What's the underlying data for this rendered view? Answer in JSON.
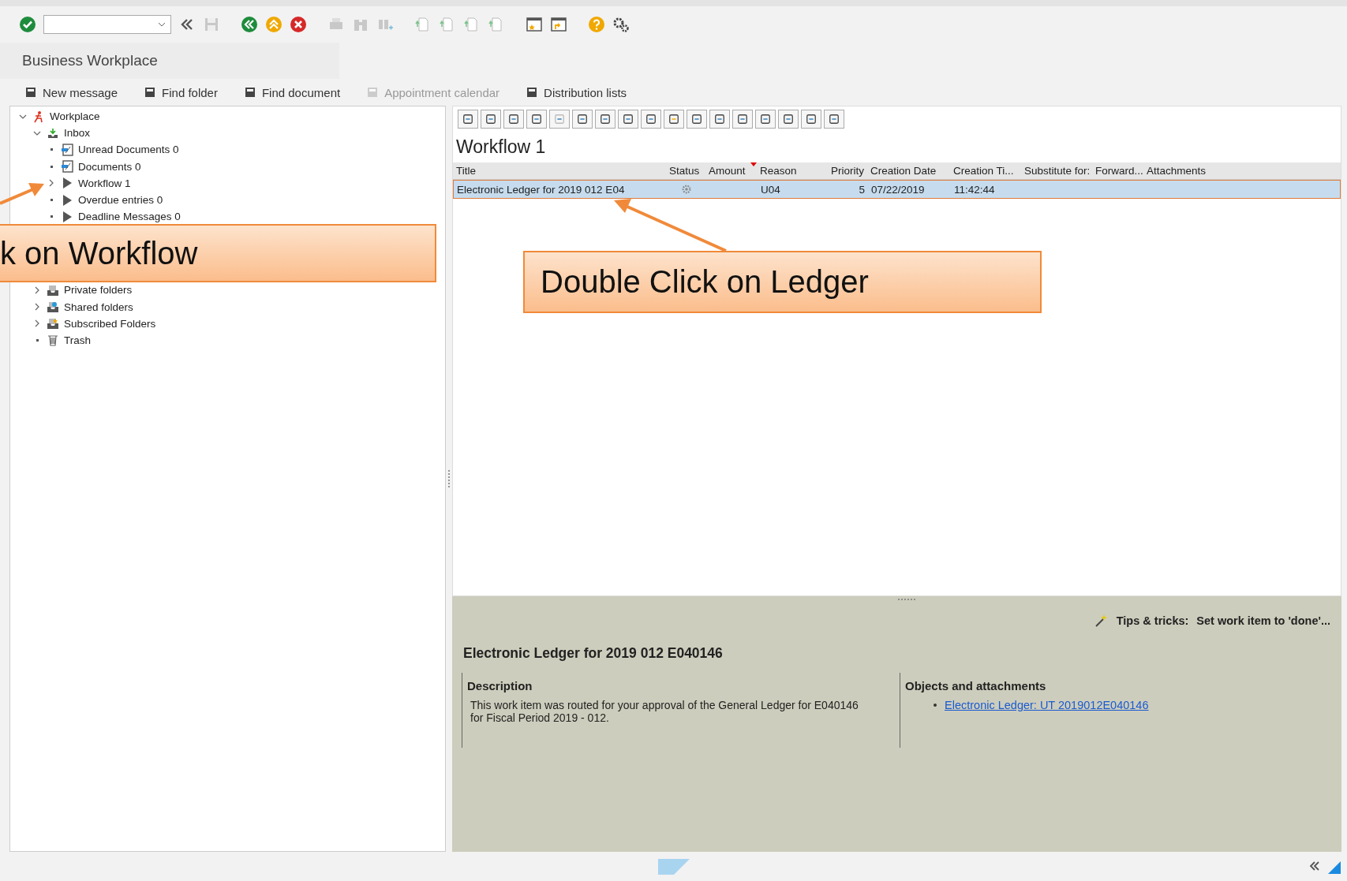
{
  "screen_title": "Business Workplace",
  "app_toolbar": [
    {
      "label": "New message",
      "disabled": false
    },
    {
      "label": "Find folder",
      "disabled": false
    },
    {
      "label": "Find document",
      "disabled": false
    },
    {
      "label": "Appointment calendar",
      "disabled": true
    },
    {
      "label": "Distribution lists",
      "disabled": false
    }
  ],
  "tree": [
    {
      "label": "Workplace",
      "kind": "root",
      "expanded": true,
      "children": [
        {
          "label": "Inbox",
          "kind": "inbox",
          "expanded": true,
          "children": [
            {
              "label": "Unread Documents 0",
              "kind": "documents"
            },
            {
              "label": "Documents 0",
              "kind": "documents"
            },
            {
              "label": "Workflow 1",
              "kind": "workflow",
              "expanded": false
            },
            {
              "label": "Overdue entries 0",
              "kind": "workflow"
            },
            {
              "label": "Deadline Messages 0",
              "kind": "workflow"
            }
          ]
        },
        {
          "label": "Private folders",
          "kind": "private",
          "expanded": false
        },
        {
          "label": "Shared folders",
          "kind": "shared",
          "expanded": false
        },
        {
          "label": "Subscribed Folders",
          "kind": "subscribed",
          "expanded": false
        },
        {
          "label": "Trash",
          "kind": "trash"
        }
      ]
    }
  ],
  "list_title": "Workflow 1",
  "table": {
    "columns": [
      {
        "label": "Title",
        "sorted": false
      },
      {
        "label": "Status",
        "sorted": false
      },
      {
        "label": "Amount",
        "sorted": true
      },
      {
        "label": "Reason",
        "sorted": false
      },
      {
        "label": "Priority",
        "sorted": false
      },
      {
        "label": "Creation Date",
        "sorted": false
      },
      {
        "label": "Creation Ti...",
        "sorted": false
      },
      {
        "label": "Substitute for:",
        "sorted": false
      },
      {
        "label": "Forward...",
        "sorted": false
      },
      {
        "label": "Attachments",
        "sorted": false
      }
    ],
    "rows": [
      {
        "title": "Electronic Ledger for 2019 012 E04",
        "reason": "U04",
        "priority": "5",
        "creation_date": "07/22/2019",
        "creation_time": "11:42:44",
        "selected": true
      }
    ]
  },
  "tips": {
    "label": "Tips & tricks:",
    "text": "Set work item to 'done'..."
  },
  "detail": {
    "title": "Electronic Ledger for 2019 012 E040146",
    "description_heading": "Description",
    "description": "This work item was routed for your approval of the General Ledger for E040146 for Fiscal Period 2019 - 012.",
    "objects_heading": "Objects and attachments",
    "objects": [
      "Electronic Ledger: UT 2019012E040146"
    ]
  },
  "callouts": [
    {
      "text": "k on Workflow"
    },
    {
      "text": "Double Click on Ledger"
    }
  ]
}
